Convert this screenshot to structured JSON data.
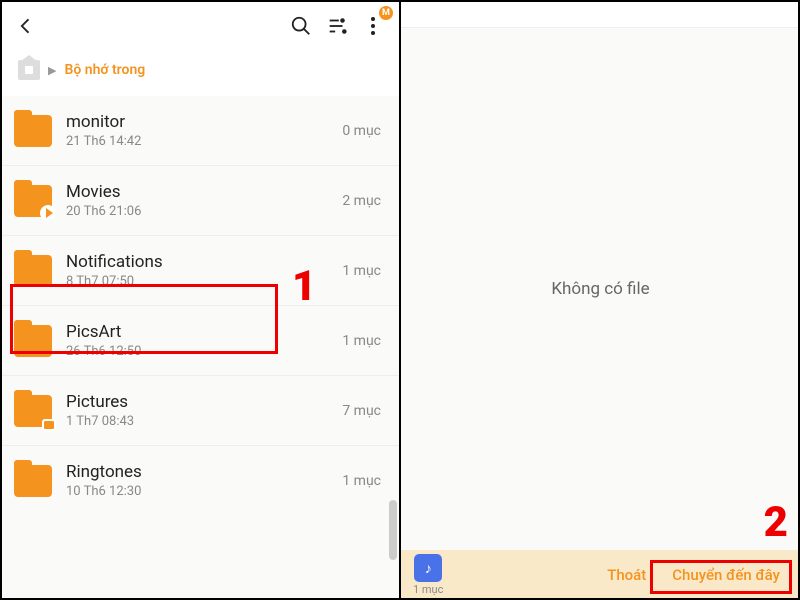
{
  "left": {
    "breadcrumb": "Bộ nhớ trong",
    "folders": [
      {
        "name": "monitor",
        "date": "21 Th6 14:42",
        "count": "0 mục",
        "overlay": null
      },
      {
        "name": "Movies",
        "date": "20 Th6 21:06",
        "count": "2 mục",
        "overlay": "play"
      },
      {
        "name": "Notifications",
        "date": "8 Th7 07:50",
        "count": "1 mục",
        "overlay": null
      },
      {
        "name": "PicsArt",
        "date": "26 Th6 12:50",
        "count": "1 mục",
        "overlay": null
      },
      {
        "name": "Pictures",
        "date": "1 Th7 08:43",
        "count": "7 mục",
        "overlay": "img"
      },
      {
        "name": "Ringtones",
        "date": "10 Th6 12:30",
        "count": "1 mục",
        "overlay": null
      }
    ],
    "menu_badge": "M"
  },
  "right": {
    "empty_text": "Không có file",
    "clip_count": "1 mục",
    "exit_label": "Thoát",
    "move_label": "Chuyển đến đây"
  },
  "annotations": {
    "one": "1",
    "two": "2"
  }
}
